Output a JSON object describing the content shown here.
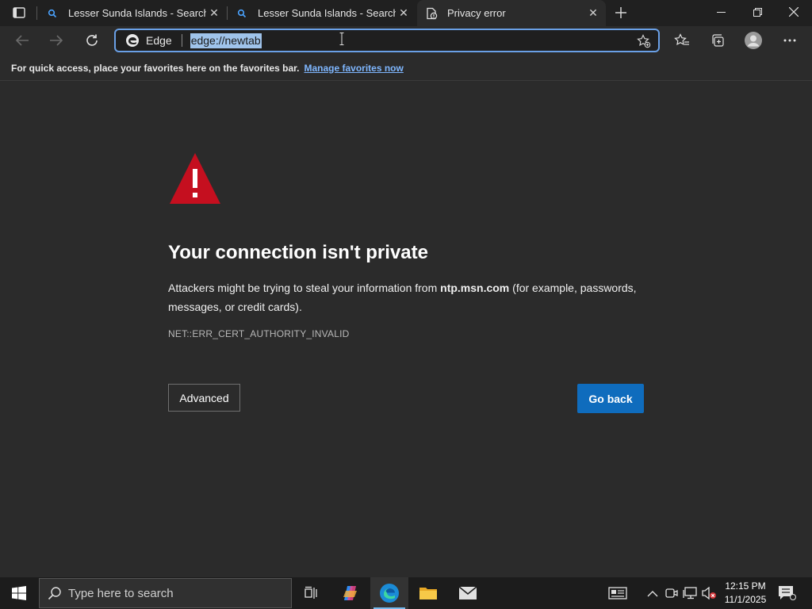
{
  "tabs": [
    {
      "title": "Lesser Sunda Islands - Search",
      "icon": "search-icon"
    },
    {
      "title": "Lesser Sunda Islands - Search",
      "icon": "search-icon"
    },
    {
      "title": "Privacy error",
      "icon": "privacy-error-icon",
      "active": true
    }
  ],
  "toolbar": {
    "edge_label": "Edge",
    "url": "edge://newtab"
  },
  "favorites_bar": {
    "message": "For quick access, place your favorites here on the favorites bar.",
    "link": "Manage favorites now"
  },
  "error_page": {
    "title": "Your connection isn't private",
    "desc_before": "Attackers might be trying to steal your information from ",
    "desc_host": "ntp.msn.com",
    "desc_after": " (for example, passwords, messages, or credit cards).",
    "code": "NET::ERR_CERT_AUTHORITY_INVALID",
    "advanced_label": "Advanced",
    "goback_label": "Go back",
    "warning_color": "#c50f1f",
    "accent_color": "#0f6cbd"
  },
  "taskbar": {
    "search_placeholder": "Type here to search",
    "time": "12:15 PM",
    "date": "11/1/2025"
  }
}
